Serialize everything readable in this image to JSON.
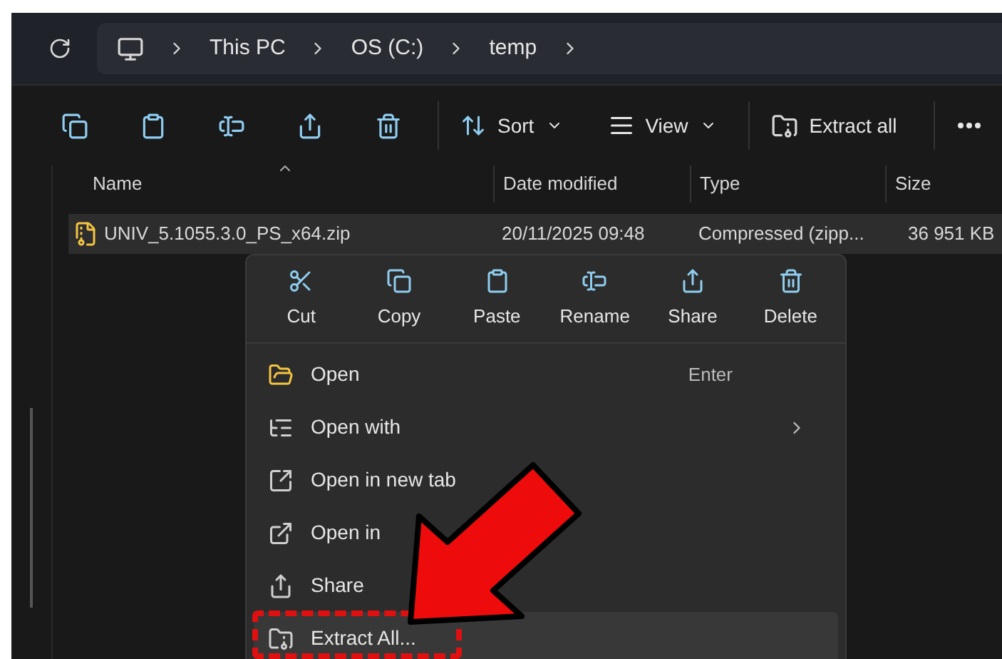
{
  "breadcrumb": [
    "This PC",
    "OS (C:)",
    "temp"
  ],
  "toolbar": {
    "sort": "Sort",
    "view": "View",
    "extract": "Extract all"
  },
  "columns": [
    "Name",
    "Date modified",
    "Type",
    "Size"
  ],
  "files": [
    {
      "name": "UNIV_5.1055.3.0_PS_x64.zip",
      "date": "20/11/2025 09:48",
      "type": "Compressed (zipp...",
      "size": "36 951 KB",
      "selected": true
    }
  ],
  "quick_actions": [
    {
      "kind": "cut",
      "label": "Cut"
    },
    {
      "kind": "copy",
      "label": "Copy"
    },
    {
      "kind": "paste",
      "label": "Paste"
    },
    {
      "kind": "rename",
      "label": "Rename"
    },
    {
      "kind": "share",
      "label": "Share"
    },
    {
      "kind": "delete",
      "label": "Delete"
    }
  ],
  "menu_items": [
    {
      "kind": "open",
      "label": "Open",
      "shortcut": "Enter",
      "highlighted": false,
      "submenu": false
    },
    {
      "kind": "open-with",
      "label": "Open with",
      "highlighted": false,
      "submenu": true
    },
    {
      "kind": "new-tab",
      "label": "Open in new tab",
      "highlighted": false,
      "submenu": false
    },
    {
      "kind": "new-window",
      "label": "Open in",
      "highlighted": false,
      "submenu": false
    },
    {
      "kind": "share",
      "label": "Share",
      "highlighted": false,
      "submenu": false
    },
    {
      "kind": "extract",
      "label": "Extract All...",
      "highlighted": true,
      "submenu": false,
      "annotated": true
    }
  ]
}
